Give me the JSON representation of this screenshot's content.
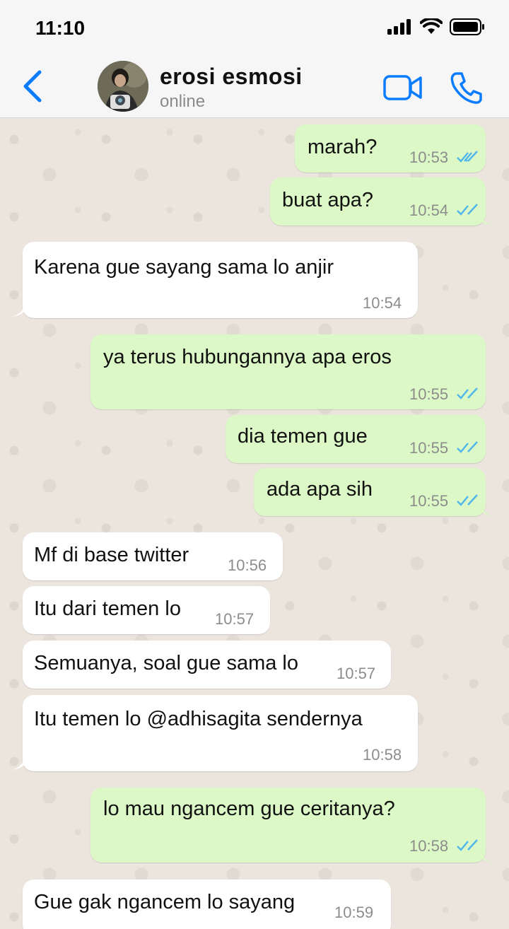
{
  "status": {
    "time": "11:10"
  },
  "header": {
    "contact_name": "erosi esmosi",
    "contact_status": "online"
  },
  "colors": {
    "accent": "#0a7cff",
    "outgoing_bubble": "#dcf8c6",
    "incoming_bubble": "#ffffff",
    "read_ticks": "#4fb6ec",
    "chat_background": "#ebe5de"
  },
  "messages": [
    {
      "direction": "out",
      "text": "marah?",
      "time": "10:53",
      "read": true
    },
    {
      "direction": "out",
      "text": "buat apa?",
      "time": "10:54",
      "read": true
    },
    {
      "direction": "in",
      "text": "Karena gue sayang sama lo anjir",
      "time": "10:54"
    },
    {
      "direction": "out",
      "text": "ya terus hubungannya apa eros",
      "time": "10:55",
      "read": true
    },
    {
      "direction": "out",
      "text": "dia temen gue",
      "time": "10:55",
      "read": true
    },
    {
      "direction": "out",
      "text": "ada apa sih",
      "time": "10:55",
      "read": true
    },
    {
      "direction": "in",
      "text": "Mf di base twitter",
      "time": "10:56"
    },
    {
      "direction": "in",
      "text": "Itu dari temen lo",
      "time": "10:57"
    },
    {
      "direction": "in",
      "text": "Semuanya, soal gue sama lo",
      "time": "10:57"
    },
    {
      "direction": "in",
      "text": "Itu temen lo @adhisagita sendernya",
      "time": "10:58"
    },
    {
      "direction": "out",
      "text": "lo mau ngancem gue ceritanya?",
      "time": "10:58",
      "read": true
    },
    {
      "direction": "in",
      "text": "Gue gak ngancem lo sayang",
      "time": "10:59"
    }
  ]
}
